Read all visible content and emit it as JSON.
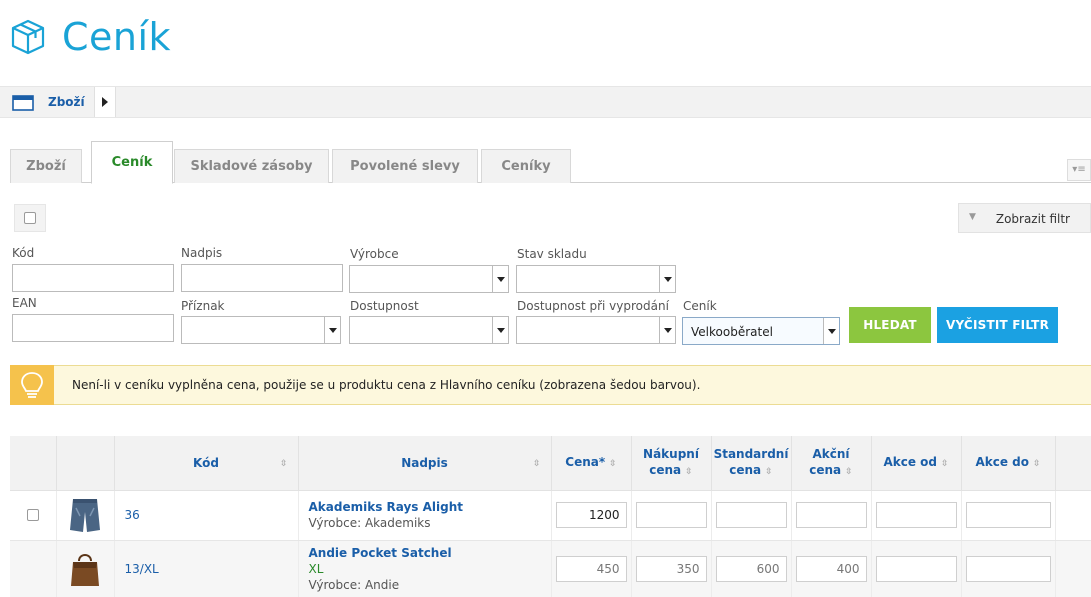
{
  "page": {
    "title": "Ceník"
  },
  "breadcrumb": {
    "label": "Zboží"
  },
  "tabs": [
    {
      "label": "Zboží",
      "active": false
    },
    {
      "label": "Ceník",
      "active": true
    },
    {
      "label": "Skladové zásoby",
      "active": false
    },
    {
      "label": "Povolené slevy",
      "active": false
    },
    {
      "label": "Ceníky",
      "active": false
    }
  ],
  "filter_toggle_label": "Zobrazit filtr",
  "filters": {
    "kod": {
      "label": "Kód",
      "value": ""
    },
    "nadpis": {
      "label": "Nadpis",
      "value": ""
    },
    "vyrobce": {
      "label": "Výrobce",
      "value": ""
    },
    "stav_skladu": {
      "label": "Stav skladu",
      "value": ""
    },
    "ean": {
      "label": "EAN",
      "value": ""
    },
    "priznak": {
      "label": "Příznak",
      "value": ""
    },
    "dostupnost": {
      "label": "Dostupnost",
      "value": ""
    },
    "dostupnost_vyprodani": {
      "label": "Dostupnost při vyprodání",
      "value": ""
    },
    "cenik": {
      "label": "Ceník",
      "value": "Velkooběratel"
    }
  },
  "buttons": {
    "search": "HLEDAT",
    "clear": "VYČISTIT FILTR"
  },
  "notice": "Není-li v ceníku vyplněna cena, použije se u produktu cena z Hlavního ceníku (zobrazena šedou barvou).",
  "table": {
    "columns": {
      "kod": "Kód",
      "nadpis": "Nadpis",
      "cena": "Cena*",
      "nakupni_1": "Nákupní",
      "nakupni_2": "cena",
      "standardni_1": "Standardní",
      "standardni_2": "cena",
      "akcni_1": "Akční",
      "akcni_2": "cena",
      "akce_od": "Akce od",
      "akce_do": "Akce do"
    },
    "rows": [
      {
        "code": "36",
        "title": "Akademiks Rays Alight",
        "variant": "",
        "maker": "Výrobce: Akademiks",
        "image": "jeans-shorts-thumbnail",
        "cena": "1200",
        "nakupni": "",
        "standardni": "",
        "akcni": "",
        "akce_od": "",
        "akce_do": ""
      },
      {
        "code": "13/XL",
        "title": "Andie Pocket Satchel",
        "variant": "XL",
        "maker": "Výrobce: Andie",
        "image": "brown-bag-thumbnail",
        "cena": "450",
        "nakupni": "350",
        "standardni": "600",
        "akcni": "400",
        "akce_od": "",
        "akce_do": ""
      }
    ]
  },
  "colors": {
    "title": "#1aa3d6",
    "link": "#1a5ea8",
    "active_tab": "#2a8a2a",
    "search_button": "#8cc63f",
    "clear_button": "#1ba1e2",
    "notice_bg": "#fdf8dd",
    "notice_icon_bg": "#f5c24c"
  }
}
